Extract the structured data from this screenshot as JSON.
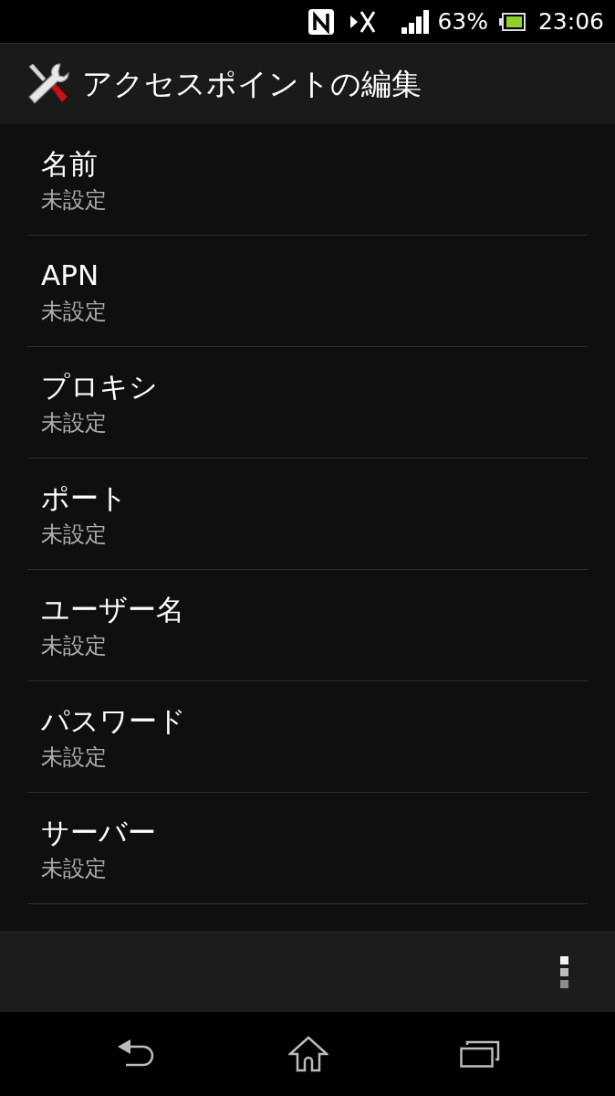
{
  "status_bar": {
    "battery": "63%",
    "time": "23:06"
  },
  "action_bar": {
    "title": "アクセスポイントの編集"
  },
  "settings": [
    {
      "title": "名前",
      "summary": "未設定"
    },
    {
      "title": "APN",
      "summary": "未設定"
    },
    {
      "title": "プロキシ",
      "summary": "未設定"
    },
    {
      "title": "ポート",
      "summary": "未設定"
    },
    {
      "title": "ユーザー名",
      "summary": "未設定"
    },
    {
      "title": "パスワード",
      "summary": "未設定"
    },
    {
      "title": "サーバー",
      "summary": "未設定"
    }
  ]
}
